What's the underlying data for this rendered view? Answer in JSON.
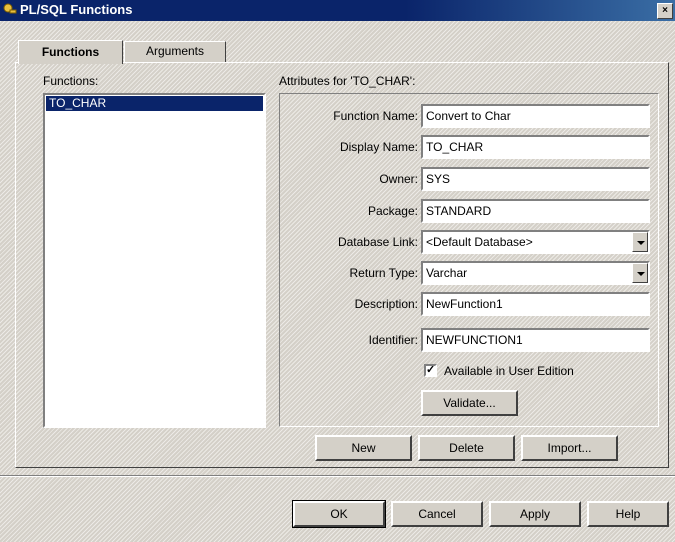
{
  "window": {
    "title": "PL/SQL Functions",
    "close_glyph": "×"
  },
  "tabs": [
    {
      "label": "Functions",
      "active": true
    },
    {
      "label": "Arguments",
      "active": false
    }
  ],
  "functions_list": {
    "label": "Functions:",
    "items": [
      "TO_CHAR"
    ],
    "selected": "TO_CHAR"
  },
  "attributes": {
    "group_label": "Attributes for 'TO_CHAR':",
    "function_name": {
      "label": "Function Name:",
      "value": "Convert to Char"
    },
    "display_name": {
      "label": "Display Name:",
      "value": "TO_CHAR"
    },
    "owner": {
      "label": "Owner:",
      "value": "SYS"
    },
    "package": {
      "label": "Package:",
      "value": "STANDARD"
    },
    "database_link": {
      "label": "Database Link:",
      "value": "<Default Database>"
    },
    "return_type": {
      "label": "Return Type:",
      "value": "Varchar"
    },
    "description": {
      "label": "Description:",
      "value": "NewFunction1"
    },
    "identifier": {
      "label": "Identifier:",
      "value": "NEWFUNCTION1"
    },
    "available_user_edition": {
      "label": "Available in User Edition",
      "checked": true
    },
    "validate_label": "Validate..."
  },
  "list_buttons": {
    "new": "New",
    "delete": "Delete",
    "import": "Import..."
  },
  "dialog_buttons": {
    "ok": "OK",
    "cancel": "Cancel",
    "apply": "Apply",
    "help": "Help"
  },
  "colors": {
    "titlebar": "#0a246a",
    "selection": "#0a246a",
    "face": "#d4d0c8"
  }
}
